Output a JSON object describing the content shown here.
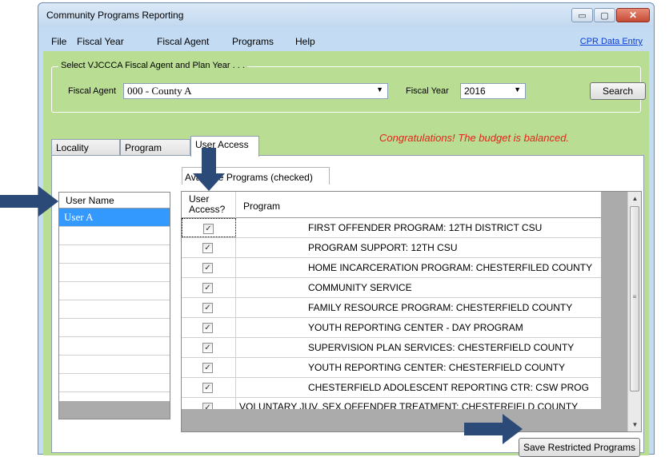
{
  "window": {
    "title": "Community Programs Reporting",
    "controls": {
      "minimize": "▭",
      "maximize": "▢",
      "close": "✕"
    }
  },
  "menu": {
    "items": [
      "File",
      "Fiscal Year",
      "Fiscal Agent",
      "Programs",
      "Help"
    ],
    "link": "CPR Data Entry"
  },
  "selector": {
    "legend": "Select VJCCCA Fiscal Agent and Plan Year . . .",
    "fiscal_agent_label": "Fiscal Agent",
    "fiscal_agent_value": "000 - County A",
    "fiscal_year_label": "Fiscal Year",
    "fiscal_year_value": "2016",
    "search_button": "Search"
  },
  "message": "Congratulations! The budget is balanced.",
  "tabs": [
    {
      "label": "Locality Plans",
      "active": false
    },
    {
      "label": "Program Plans",
      "active": false
    },
    {
      "label": "User Access",
      "active": true
    }
  ],
  "user_access": {
    "programs_caption": "Available Programs (checked)",
    "user_grid": {
      "header": "User Name",
      "rows": [
        "User A",
        "",
        "",
        "",
        "",
        "",
        "",
        "",
        "",
        ""
      ]
    },
    "program_grid": {
      "headers": {
        "access_line1": "User",
        "access_line2": "Access?",
        "program": "Program"
      },
      "rows": [
        {
          "checked": true,
          "program": "FIRST OFFENDER PROGRAM: 12TH DISTRICT CSU"
        },
        {
          "checked": true,
          "program": "PROGRAM SUPPORT: 12TH CSU"
        },
        {
          "checked": true,
          "program": "HOME INCARCERATION PROGRAM: CHESTERFILED COUNTY"
        },
        {
          "checked": true,
          "program": "COMMUNITY SERVICE"
        },
        {
          "checked": true,
          "program": "FAMILY RESOURCE PROGRAM: CHESTERFIELD COUNTY"
        },
        {
          "checked": true,
          "program": "YOUTH REPORTING CENTER - DAY PROGRAM"
        },
        {
          "checked": true,
          "program": "SUPERVISION PLAN SERVICES: CHESTERFIELD COUNTY"
        },
        {
          "checked": true,
          "program": "YOUTH REPORTING CENTER:  CHESTERFIELD COUNTY"
        },
        {
          "checked": true,
          "program": "CHESTERFIELD ADOLESCENT REPORTING CTR: CSW PROG"
        },
        {
          "checked": true,
          "program": "VOLUNTARY JUV. SEX OFFENDER TREATMENT: CHESTERFIELD COUNTY"
        }
      ]
    },
    "save_button": "Save Restricted Programs"
  },
  "colors": {
    "window_frame": "#c4dcf3",
    "client_background": "#b9dd93",
    "message_text": "#e3261a",
    "selection": "#3399ff",
    "link": "#0a3dd6",
    "annotation_arrow": "#2b4a78"
  },
  "icons": {
    "checkbox_mark": "✓",
    "dropdown": "▼",
    "scroll_up": "▲",
    "scroll_down": "▼",
    "scroll_grip": "≡"
  }
}
